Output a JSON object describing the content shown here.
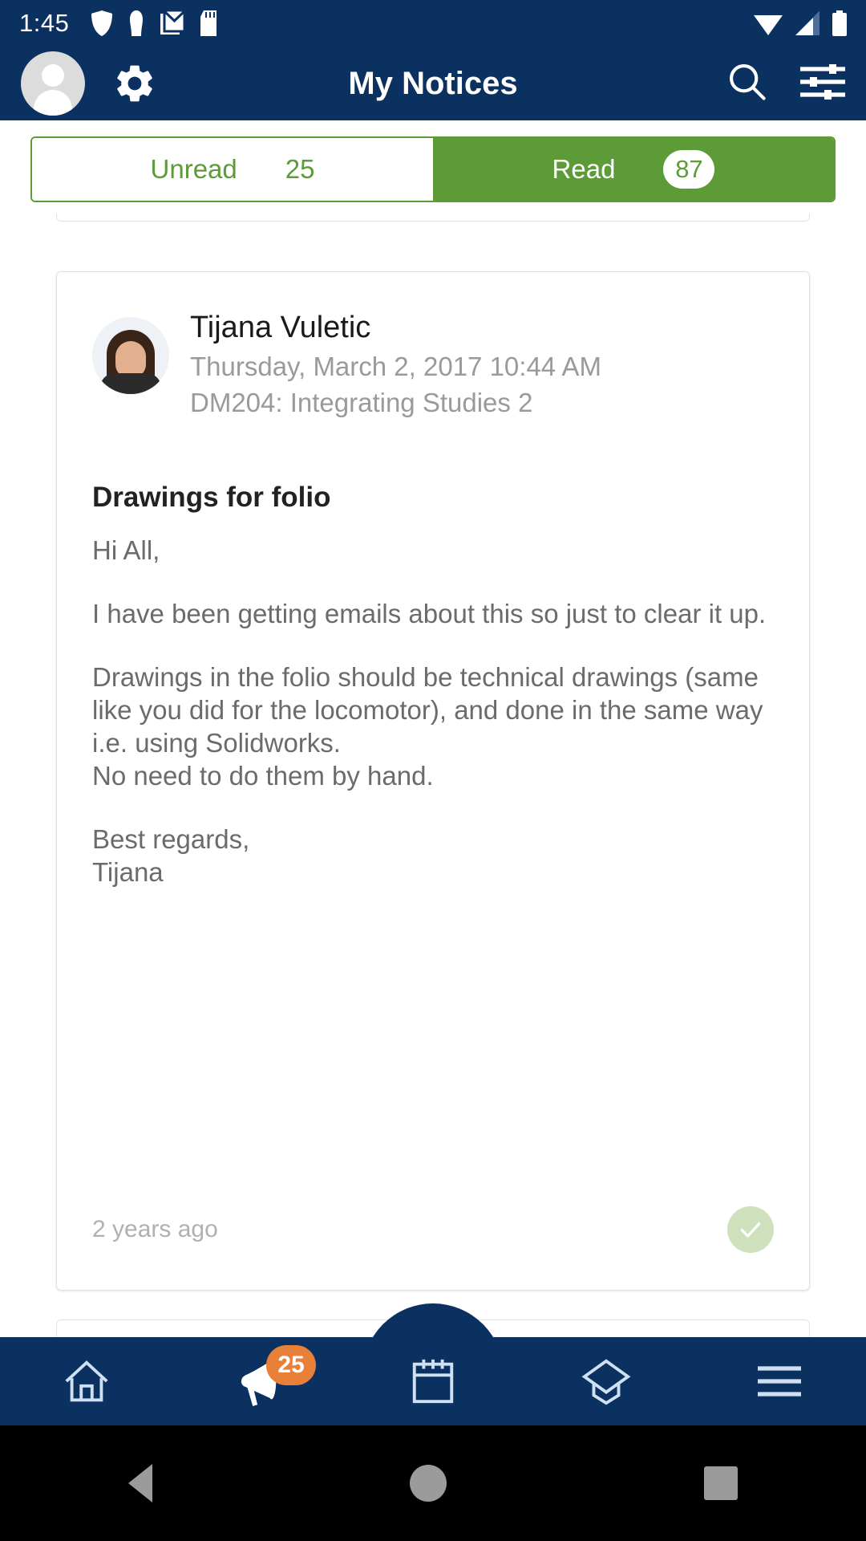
{
  "status_bar": {
    "time": "1:45",
    "left_icons": [
      "shield-icon",
      "vpn-key-icon",
      "gmail-icon",
      "sd-card-icon"
    ],
    "right_icons": [
      "wifi-icon",
      "signal-icon",
      "battery-icon"
    ]
  },
  "app_bar": {
    "title": "My Notices",
    "avatar_icon": "account-avatar-icon",
    "settings_icon": "gear-icon",
    "search_icon": "search-icon",
    "filter_icon": "filter-sliders-icon"
  },
  "tabs": [
    {
      "label": "Unread",
      "count": "25",
      "selected": false,
      "style": "plain"
    },
    {
      "label": "Read",
      "count": "87",
      "selected": true,
      "style": "pill"
    }
  ],
  "notice": {
    "sender": "Tijana Vuletic",
    "date": "Thursday, March 2, 2017 10:44 AM",
    "course": "DM204: Integrating Studies 2",
    "subject": "Drawings for folio",
    "body": [
      "Hi All,",
      "I have been getting emails about this so just to clear it up.",
      "Drawings in the folio should be technical drawings (same like you did for the locomotor), and done in the same way i.e. using Solidworks.",
      "No need to do them by hand.",
      "Best regards,",
      "Tijana"
    ],
    "time_ago": "2 years ago",
    "mark_read_icon": "check-icon"
  },
  "bottom_nav": [
    {
      "icon": "home-icon",
      "badge": null
    },
    {
      "icon": "megaphone-icon",
      "badge": "25"
    },
    {
      "icon": "calendar-icon",
      "badge": null
    },
    {
      "icon": "graduation-cap-icon",
      "badge": null
    },
    {
      "icon": "hamburger-menu-icon",
      "badge": null
    }
  ],
  "android_nav": {
    "back_icon": "back-triangle-icon",
    "home_icon": "home-circle-icon",
    "recents_icon": "recents-square-icon"
  },
  "colors": {
    "primary_navy": "#0b3161",
    "accent_green": "#5c9b37",
    "badge_orange": "#e8803a"
  }
}
